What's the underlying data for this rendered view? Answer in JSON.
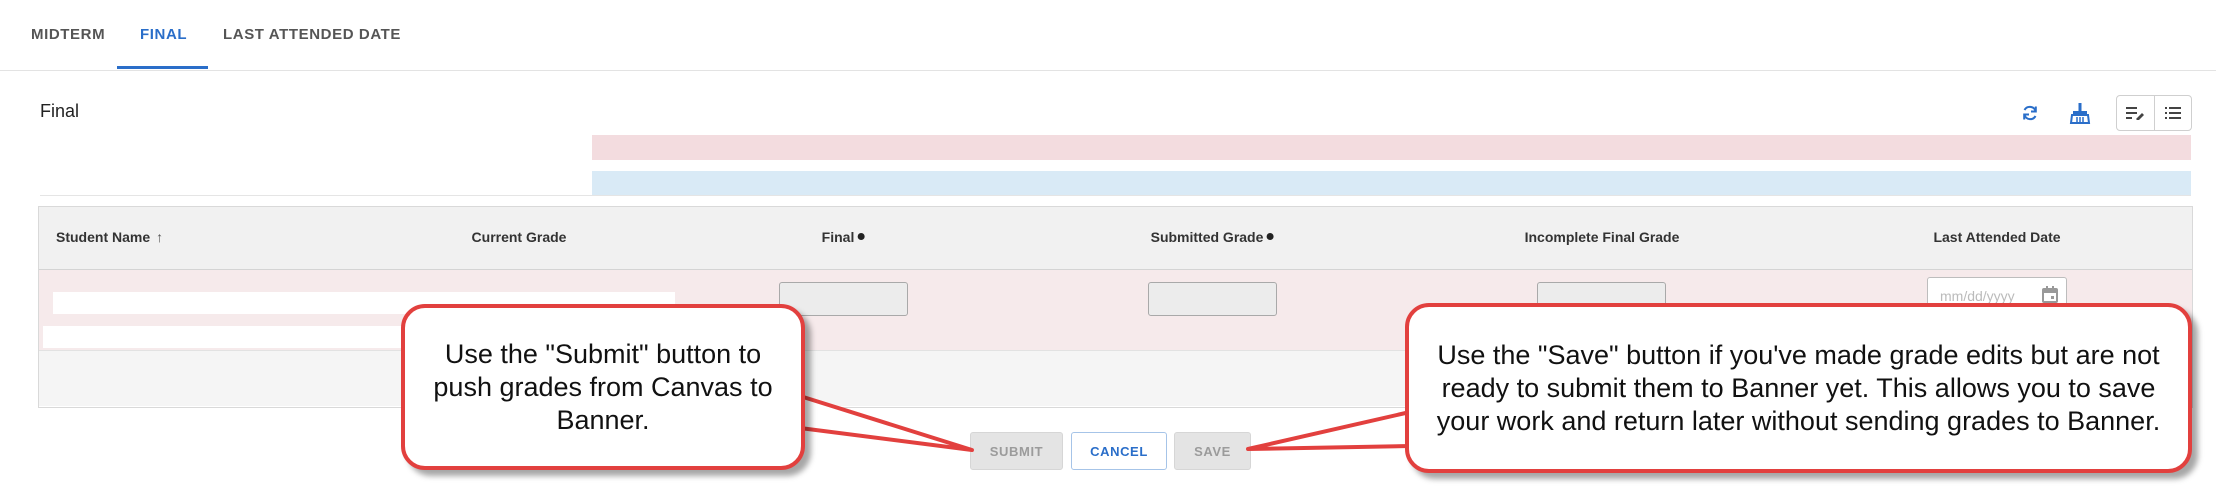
{
  "tabs": [
    {
      "label": "MIDTERM",
      "active": false
    },
    {
      "label": "FINAL",
      "active": true
    },
    {
      "label": "LAST ATTENDED DATE",
      "active": false
    }
  ],
  "section": {
    "title": "Final"
  },
  "toolbar": {
    "icons": [
      "refresh-icon",
      "broom-icon",
      "edit-list-icon",
      "list-icon"
    ]
  },
  "grid": {
    "columns": [
      {
        "label": "Student Name",
        "sort": "ascending"
      },
      {
        "label": "Current Grade"
      },
      {
        "label": "Final",
        "required": true
      },
      {
        "label": "Submitted Grade",
        "required": true
      },
      {
        "label": "Incomplete Final Grade"
      },
      {
        "label": "Last Attended Date"
      }
    ],
    "date_placeholder": "mm/dd/yyyy"
  },
  "buttons": {
    "submit": "SUBMIT",
    "cancel": "CANCEL",
    "save": "SAVE"
  },
  "callouts": {
    "submit": "Use the \"Submit\" button to push grades from Canvas to Banner.",
    "save": "Use the \"Save\" button if you've made grade edits but are not ready to submit them to Banner yet. This allows you to save your work and return later without sending grades to Banner."
  },
  "colors": {
    "accent": "#2a6ec9",
    "callout_border": "#e2403e",
    "banner_error": "#f3dcdf",
    "banner_info": "#d9eaf6"
  }
}
